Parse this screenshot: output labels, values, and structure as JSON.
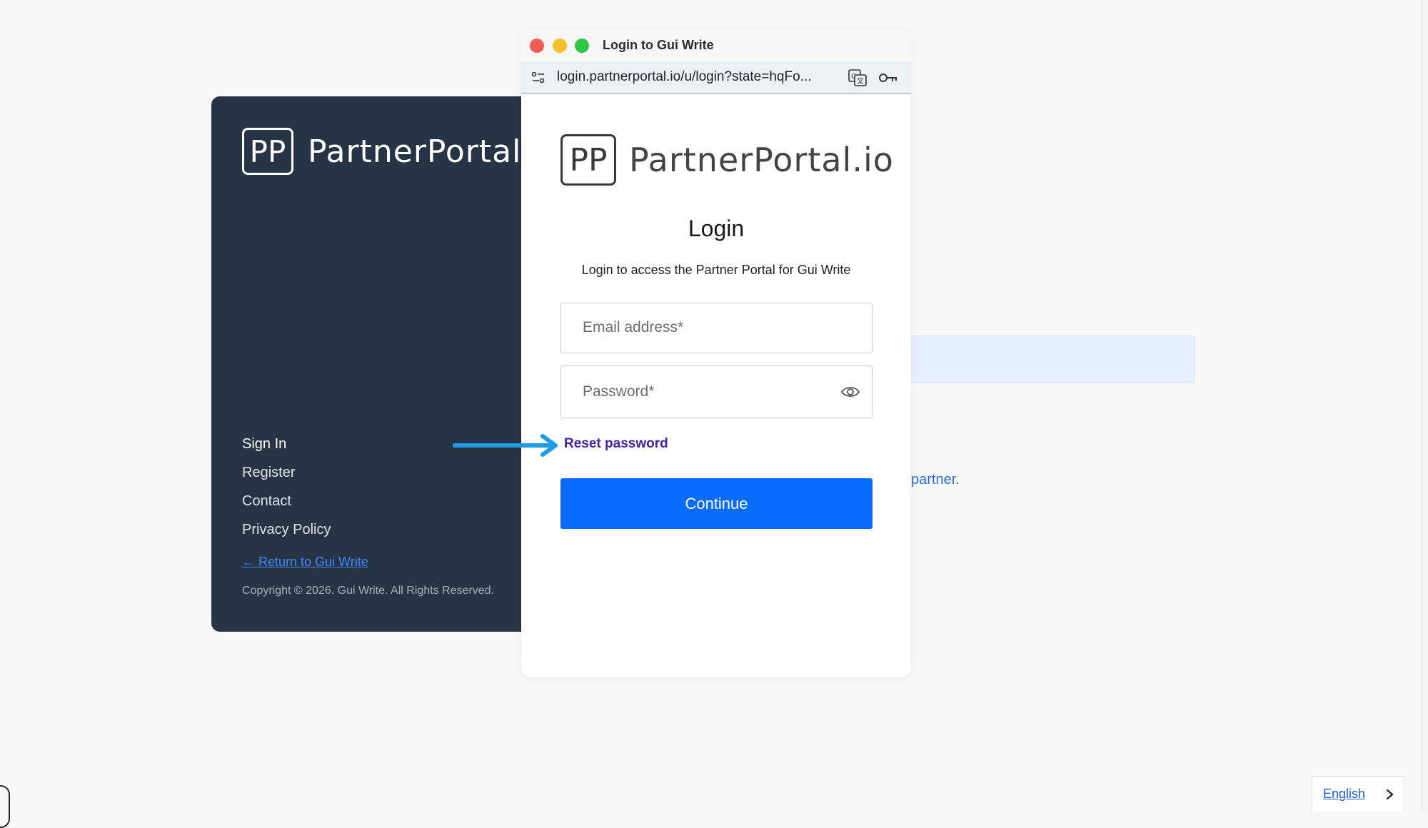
{
  "background": {
    "brand": "PartnerPortal.io",
    "logo_monogram": "PP",
    "nav": {
      "sign_in": "Sign In",
      "register": "Register",
      "contact": "Contact",
      "privacy_policy": "Privacy Policy"
    },
    "return_link": "← Return to Gui Write",
    "copyright": "Copyright © 2026. Gui Write. All Rights Reserved.",
    "partner_link": "partner.",
    "colors": {
      "panel": "#263445",
      "link": "#3d8bff"
    }
  },
  "popup": {
    "window_title": "Login to Gui Write",
    "url": "login.partnerportal.io/u/login?state=hqFo...",
    "icons": {
      "site_settings": "site-settings-icon",
      "translate": "translate-icon",
      "password_key": "key-icon",
      "show_password": "eye-icon"
    },
    "logo_monogram": "PP",
    "brand": "PartnerPortal.io",
    "title": "Login",
    "subtitle": "Login to access the Partner Portal for Gui Write",
    "email_placeholder": "Email address*",
    "password_placeholder": "Password*",
    "reset_password": "Reset password",
    "continue": "Continue",
    "colors": {
      "primary_button": "#0a6cff",
      "reset_link": "#4a1ea0"
    }
  },
  "language": {
    "selected": "English"
  },
  "annotation": {
    "arrow_color": "#1e9be8"
  }
}
